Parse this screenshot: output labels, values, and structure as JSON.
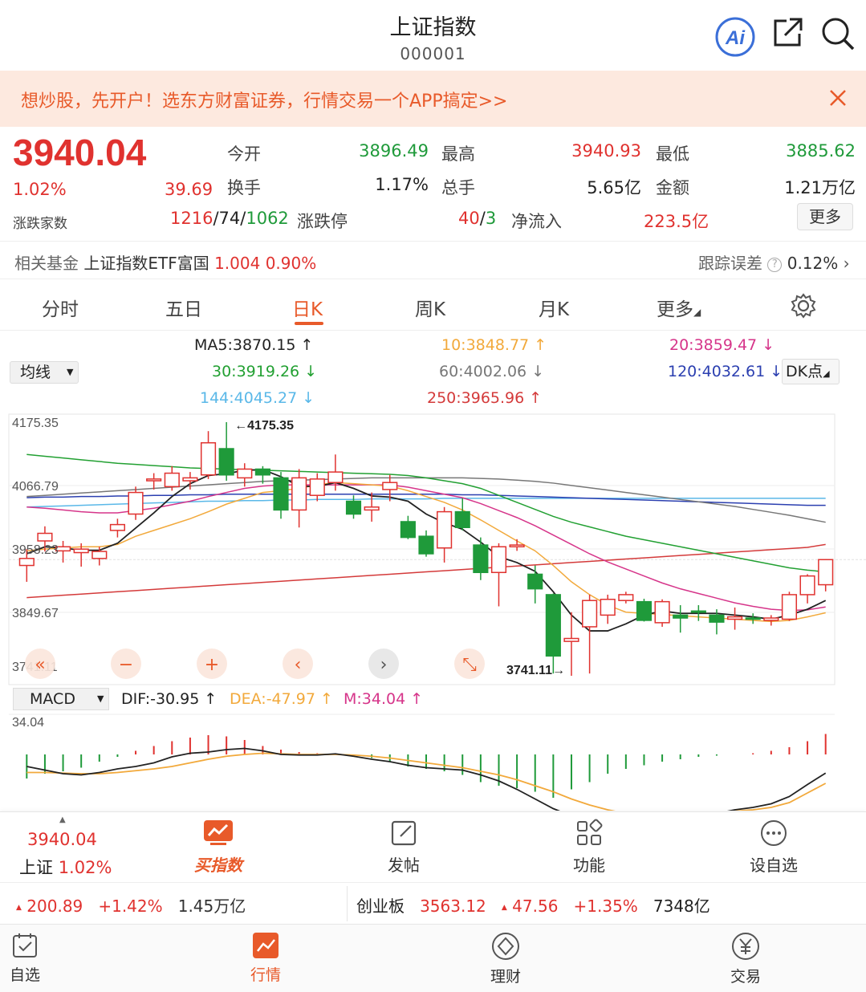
{
  "header": {
    "title": "上证指数",
    "code": "000001"
  },
  "promo": {
    "text": "想炒股，先开户！选东方财富证券，行情交易一个APP搞定>>"
  },
  "quote": {
    "price": "3940.04",
    "change_pct": "1.02%",
    "change": "39.69",
    "open_label": "今开",
    "open": "3896.49",
    "high_label": "最高",
    "high": "3940.93",
    "low_label": "最低",
    "low": "3885.62",
    "turnover_label": "换手",
    "turnover": "1.17%",
    "volume_label": "总手",
    "volume": "5.65亿",
    "amount_label": "金额",
    "amount": "1.21万亿",
    "breadth_label": "涨跌家数",
    "up": "1216",
    "flat": "74",
    "down": "1062",
    "sep": "/",
    "limit_label": "涨跌停",
    "limit_up": "40",
    "limit_down": "3",
    "netflow_label": "净流入",
    "netflow": "223.5亿",
    "more_label": "更多"
  },
  "fund": {
    "label": "相关基金",
    "name": "上证指数ETF富国",
    "price": "1.004",
    "pct": "0.90%",
    "tracking_label": "跟踪误差",
    "tracking_value": "0.12%"
  },
  "tabs": [
    "分时",
    "五日",
    "日K",
    "周K",
    "月K",
    "更多"
  ],
  "ma_legend": {
    "select": "均线",
    "ma5": "MA5:3870.15",
    "ma10": "10:3848.77",
    "ma20": "20:3859.47",
    "ma30": "30:3919.26",
    "ma60": "60:4002.06",
    "ma120": "120:4032.61",
    "ma144": "144:4045.27",
    "ma250": "250:3965.96",
    "dk": "DK点"
  },
  "colors": {
    "up": "#e0322f",
    "down": "#1f9a3a",
    "accent": "#e85a2a",
    "ma5": "#222222",
    "ma10": "#f2a93b",
    "ma20": "#d6358a",
    "ma30": "#22a032",
    "ma60": "#777777",
    "ma120": "#2b3fb0",
    "ma144": "#5ab8e8",
    "ma250": "#d43a3a"
  },
  "chart_data": {
    "type": "candlestick",
    "y_ticks": [
      "4175.35",
      "4066.79",
      "3958.23",
      "3849.67",
      "3741.11"
    ],
    "ylim": [
      3741.11,
      4175.35
    ],
    "max_label": "4175.35",
    "min_label": "3741.11",
    "candles": [
      [
        3930,
        3942,
        3902,
        3958
      ],
      [
        3972,
        3985,
        3954,
        3997
      ],
      [
        3955,
        3962,
        3935,
        3972
      ],
      [
        3952,
        3958,
        3928,
        3968
      ],
      [
        3942,
        3954,
        3930,
        3962
      ],
      [
        3990,
        4000,
        3978,
        4010
      ],
      [
        4018,
        4055,
        4008,
        4065
      ],
      [
        4075,
        4078,
        4060,
        4088
      ],
      [
        4065,
        4088,
        4058,
        4100
      ],
      [
        4075,
        4080,
        4060,
        4090
      ],
      [
        4085,
        4140,
        4078,
        4160
      ],
      [
        4130,
        4085,
        4075,
        4175.35
      ],
      [
        4080,
        4095,
        4065,
        4105
      ],
      [
        4095,
        4085,
        4070,
        4100
      ],
      [
        4080,
        4025,
        4010,
        4090
      ],
      [
        4025,
        4080,
        3995,
        4095
      ],
      [
        4050,
        4078,
        4040,
        4088
      ],
      [
        4072,
        4090,
        4058,
        4120
      ],
      [
        4040,
        4018,
        4010,
        4050
      ],
      [
        4025,
        4030,
        4005,
        4055
      ],
      [
        4060,
        4072,
        4040,
        4085
      ],
      [
        4005,
        3978,
        3975,
        4015
      ],
      [
        3980,
        3950,
        3945,
        3990
      ],
      [
        3960,
        4022,
        3935,
        4030
      ],
      [
        4022,
        3995,
        3990,
        4045
      ],
      [
        3965,
        3918,
        3905,
        3978
      ],
      [
        3918,
        3962,
        3860,
        3968
      ],
      [
        3962,
        3965,
        3955,
        3975
      ],
      [
        3915,
        3890,
        3865,
        3930
      ],
      [
        3880,
        3775,
        3745,
        3882
      ],
      [
        3800,
        3805,
        3741.11,
        3850
      ],
      [
        3825,
        3870,
        3745,
        3880
      ],
      [
        3845,
        3872,
        3830,
        3880
      ],
      [
        3870,
        3880,
        3865,
        3885
      ],
      [
        3868,
        3836,
        3834,
        3873
      ],
      [
        3832,
        3868,
        3825,
        3872
      ],
      [
        3845,
        3840,
        3815,
        3862
      ],
      [
        3852,
        3850,
        3835,
        3862
      ],
      [
        3845,
        3833,
        3812,
        3855
      ],
      [
        3838,
        3842,
        3820,
        3858
      ],
      [
        3840,
        3838,
        3830,
        3848
      ],
      [
        3836,
        3840,
        3827,
        3845
      ],
      [
        3838,
        3880,
        3835,
        3885
      ],
      [
        3880,
        3912,
        3865,
        3915
      ],
      [
        3897,
        3940,
        3885.62,
        3940.93
      ]
    ],
    "ma": {
      "ma5": [
        3950,
        3962,
        3960,
        3956,
        3956,
        3968,
        3994,
        4020,
        4048,
        4070,
        4084,
        4087,
        4093,
        4094,
        4082,
        4066,
        4065,
        4072,
        4062,
        4049,
        4047,
        4040,
        4018,
        4003,
        3992,
        3970,
        3945,
        3935,
        3920,
        3885,
        3845,
        3818,
        3818,
        3830,
        3845,
        3852,
        3848,
        3848,
        3848,
        3845,
        3842,
        3838,
        3845,
        3855,
        3870
      ],
      "ma10": [
        3955,
        3958,
        3960,
        3962,
        3962,
        3966,
        3980,
        3990,
        4000,
        4010,
        4022,
        4035,
        4045,
        4055,
        4058,
        4062,
        4068,
        4072,
        4070,
        4068,
        4066,
        4058,
        4048,
        4038,
        4025,
        4008,
        3990,
        3972,
        3955,
        3930,
        3902,
        3880,
        3862,
        3850,
        3848,
        3846,
        3844,
        3842,
        3840,
        3838,
        3836,
        3834,
        3836,
        3842,
        3849
      ],
      "ma20": [
        4030,
        4028,
        4025,
        4022,
        4020,
        4020,
        4024,
        4028,
        4034,
        4040,
        4048,
        4055,
        4062,
        4066,
        4068,
        4068,
        4068,
        4068,
        4068,
        4068,
        4068,
        4064,
        4058,
        4052,
        4046,
        4036,
        4024,
        4012,
        3998,
        3982,
        3966,
        3950,
        3936,
        3924,
        3912,
        3900,
        3890,
        3882,
        3874,
        3866,
        3860,
        3855,
        3853,
        3854,
        3859
      ],
      "ma30": [
        4120,
        4117,
        4114,
        4111,
        4108,
        4105,
        4103,
        4101,
        4099,
        4097,
        4096,
        4095,
        4094,
        4093,
        4092,
        4091,
        4090,
        4089,
        4088,
        4087,
        4086,
        4084,
        4080,
        4075,
        4070,
        4062,
        4050,
        4038,
        4026,
        4014,
        4004,
        3996,
        3988,
        3980,
        3974,
        3968,
        3962,
        3956,
        3950,
        3944,
        3938,
        3932,
        3926,
        3922,
        3919
      ],
      "ma60": [
        4048,
        4050,
        4052,
        4054,
        4056,
        4058,
        4060,
        4062,
        4064,
        4066,
        4068,
        4070,
        4072,
        4074,
        4075,
        4076,
        4077,
        4078,
        4079,
        4080,
        4080,
        4080,
        4080,
        4080,
        4080,
        4079,
        4078,
        4076,
        4074,
        4071,
        4067,
        4063,
        4059,
        4055,
        4051,
        4047,
        4043,
        4039,
        4035,
        4031,
        4026,
        4021,
        4016,
        4010,
        4004
      ],
      "ma120": [
        4046,
        4047,
        4047,
        4048,
        4048,
        4049,
        4049,
        4050,
        4050,
        4051,
        4051,
        4052,
        4052,
        4052,
        4052,
        4052,
        4052,
        4052,
        4052,
        4052,
        4052,
        4052,
        4052,
        4052,
        4051,
        4051,
        4050,
        4049,
        4048,
        4047,
        4046,
        4045,
        4044,
        4043,
        4042,
        4041,
        4040,
        4039,
        4038,
        4037,
        4036,
        4035,
        4034,
        4033,
        4033
      ],
      "ma144": [
        4030,
        4031,
        4032,
        4033,
        4034,
        4035,
        4036,
        4037,
        4038,
        4039,
        4040,
        4040,
        4041,
        4041,
        4042,
        4042,
        4043,
        4043,
        4043,
        4044,
        4044,
        4044,
        4044,
        4045,
        4045,
        4045,
        4045,
        4045,
        4045,
        4045,
        4045,
        4045,
        4045,
        4045,
        4045,
        4045,
        4045,
        4045,
        4045,
        4045,
        4045,
        4045,
        4045,
        4045,
        4045
      ],
      "ma250": [
        3875,
        3877,
        3879,
        3881,
        3883,
        3885,
        3887,
        3889,
        3891,
        3893,
        3895,
        3897,
        3899,
        3901,
        3903,
        3905,
        3907,
        3909,
        3911,
        3913,
        3915,
        3917,
        3919,
        3921,
        3923,
        3925,
        3927,
        3929,
        3931,
        3933,
        3935,
        3937,
        3939,
        3941,
        3943,
        3945,
        3947,
        3949,
        3951,
        3953,
        3955,
        3957,
        3959,
        3961,
        3966
      ]
    },
    "macd": {
      "label": "MACD",
      "dif": "DIF:-30.95",
      "dea": "DEA:-47.97",
      "m": "M:34.04",
      "top_label": "34.04",
      "hist": [
        -40,
        -32,
        -28,
        -22,
        -12,
        -4,
        6,
        14,
        22,
        28,
        32,
        30,
        24,
        14,
        8,
        4,
        2,
        1,
        -2,
        -6,
        -12,
        -20,
        -24,
        -28,
        -34,
        -46,
        -52,
        -56,
        -62,
        -72,
        -58,
        -46,
        -32,
        -24,
        -18,
        -12,
        -8,
        -4,
        -2,
        0,
        2,
        6,
        12,
        22,
        34
      ],
      "dif_line": [
        -20,
        -26,
        -32,
        -34,
        -30,
        -24,
        -20,
        -14,
        -4,
        2,
        4,
        8,
        10,
        6,
        0,
        -1,
        -1,
        1,
        -3,
        -8,
        -12,
        -18,
        -22,
        -24,
        -26,
        -34,
        -44,
        -58,
        -74,
        -90,
        -102,
        -110,
        -114,
        -114,
        -112,
        -110,
        -106,
        -102,
        -98,
        -92,
        -88,
        -82,
        -70,
        -50,
        -31
      ],
      "dea_line": [
        -30,
        -30,
        -31,
        -32,
        -32,
        -30,
        -27,
        -24,
        -20,
        -14,
        -8,
        -3,
        0,
        2,
        1,
        0,
        0,
        0,
        -1,
        -3,
        -6,
        -10,
        -14,
        -18,
        -22,
        -28,
        -34,
        -42,
        -52,
        -62,
        -74,
        -84,
        -92,
        -98,
        -100,
        -100,
        -99,
        -98,
        -96,
        -94,
        -92,
        -88,
        -80,
        -64,
        -48
      ]
    }
  },
  "chart_controls": [
    "«",
    "−",
    "+",
    "‹",
    "›",
    "⤡"
  ],
  "bottom": {
    "index_price": "3940.04",
    "index_name": "上证",
    "index_pct": "1.02%",
    "buy_label": "买指数",
    "post_label": "发帖",
    "func_label": "功能",
    "watch_label": "设自选"
  },
  "ticker": {
    "left_change": "200.89",
    "left_pct": "+1.42%",
    "left_amount": "1.45万亿",
    "name": "创业板",
    "price": "3563.12",
    "change": "47.56",
    "pct": "+1.35%",
    "amount": "7348亿"
  },
  "tabbar": [
    "自选",
    "行情",
    "理财",
    "交易"
  ]
}
